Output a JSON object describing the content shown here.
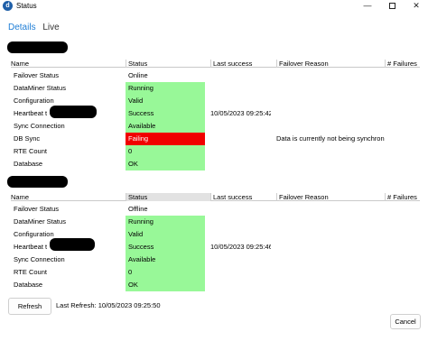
{
  "window": {
    "title": "Status",
    "minimize_glyph": "—",
    "close_glyph": "✕",
    "app_icon_letter": "d"
  },
  "tabs": [
    {
      "label": "Details",
      "active": true
    },
    {
      "label": "Live",
      "active": false
    }
  ],
  "columns": [
    "Name",
    "Status",
    "Last success",
    "Failover Reason",
    "# Failures"
  ],
  "grids": [
    {
      "rows": [
        {
          "name": "Failover Status",
          "status": "Online",
          "state": "plain",
          "last_success": "",
          "reason": ""
        },
        {
          "name": "DataMiner Status",
          "status": "Running",
          "state": "ok",
          "last_success": "",
          "reason": ""
        },
        {
          "name": "Configuration",
          "status": "Valid",
          "state": "ok",
          "last_success": "",
          "reason": ""
        },
        {
          "name": "Heartbeat t",
          "status": "Success",
          "state": "ok",
          "last_success": "10/05/2023 09:25:42",
          "reason": ""
        },
        {
          "name": "Sync Connection",
          "status": "Available",
          "state": "ok",
          "last_success": "",
          "reason": ""
        },
        {
          "name": "DB Sync",
          "status": "Failing",
          "state": "error",
          "last_success": "",
          "reason": "Data is currently not being synchronized"
        },
        {
          "name": "RTE Count",
          "status": "0",
          "state": "ok",
          "last_success": "",
          "reason": ""
        },
        {
          "name": "Database",
          "status": "OK",
          "state": "ok",
          "last_success": "",
          "reason": ""
        }
      ]
    },
    {
      "rows": [
        {
          "name": "Failover Status",
          "status": "Offline",
          "state": "plain",
          "last_success": "",
          "reason": ""
        },
        {
          "name": "DataMiner Status",
          "status": "Running",
          "state": "ok",
          "last_success": "",
          "reason": ""
        },
        {
          "name": "Configuration",
          "status": "Valid",
          "state": "ok",
          "last_success": "",
          "reason": ""
        },
        {
          "name": "Heartbeat t",
          "status": "Success",
          "state": "ok",
          "last_success": "10/05/2023 09:25:46",
          "reason": ""
        },
        {
          "name": "Sync Connection",
          "status": "Available",
          "state": "ok",
          "last_success": "",
          "reason": ""
        },
        {
          "name": "RTE Count",
          "status": "0",
          "state": "ok",
          "last_success": "",
          "reason": ""
        },
        {
          "name": "Database",
          "status": "OK",
          "state": "ok",
          "last_success": "",
          "reason": ""
        }
      ]
    }
  ],
  "footer": {
    "refresh_label": "Refresh",
    "last_refresh_text": "Last Refresh: 10/05/2023 09:25:50",
    "cancel_label": "Cancel"
  },
  "colors": {
    "ok": "#98f898",
    "error": "#f00000",
    "accent": "#1f7ed6"
  }
}
